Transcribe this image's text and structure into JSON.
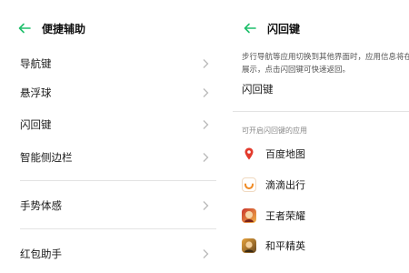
{
  "left": {
    "title": "便捷辅助",
    "items": [
      "导航键",
      "悬浮球",
      "闪回键",
      "智能侧边栏",
      "手势体感",
      "红包助手"
    ]
  },
  "right": {
    "title": "闪回键",
    "description_line1": "步行导航等应用切换到其他界面时，应用信息将在闪",
    "description_line2": "展示，点击闪回键可快速返回。",
    "toggle_label": "闪回键",
    "section_label": "可开启闪回键的应用",
    "apps": [
      "百度地图",
      "滴滴出行",
      "王者荣耀",
      "和平精英"
    ]
  },
  "colors": {
    "accent": "#1fbf6b",
    "chevron": "#b9b9b9",
    "didi": "#f08a24",
    "baidu_pin": "#e33a2c"
  },
  "icons": {
    "back": "arrow-left-icon",
    "chevron": "chevron-right-icon"
  }
}
